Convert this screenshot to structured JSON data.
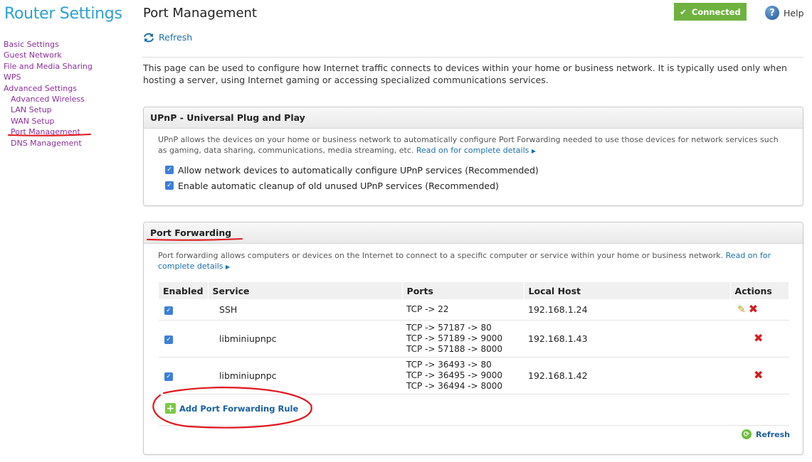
{
  "sidebar": {
    "brand": "Router Settings",
    "items": [
      {
        "label": "Basic Settings"
      },
      {
        "label": "Guest Network"
      },
      {
        "label": "File and Media Sharing"
      },
      {
        "label": "WPS"
      },
      {
        "label": "Advanced Settings"
      },
      {
        "label": "Advanced Wireless"
      },
      {
        "label": "LAN Setup"
      },
      {
        "label": "WAN Setup"
      },
      {
        "label": "Port Management"
      },
      {
        "label": "DNS Management"
      }
    ]
  },
  "header": {
    "title": "Port Management",
    "refresh_label": "Refresh",
    "status_label": "Connected",
    "help_label": "Help"
  },
  "intro": "This page can be used to configure how Internet traffic connects to devices within your home or business network. It is typically used only when hosting a server, using Internet gaming or accessing specialized communications services.",
  "upnp": {
    "title": "UPnP - Universal Plug and Play",
    "description": "UPnP allows the devices on your home or business network to automatically configure Port Forwarding needed to use those devices for network services such as gaming, data sharing, communications, media streaming, etc.",
    "link": "Read on for complete details",
    "options": [
      {
        "label": "Allow network devices to automatically configure UPnP services (Recommended)",
        "checked": true
      },
      {
        "label": "Enable automatic cleanup of old unused UPnP services (Recommended)",
        "checked": true
      }
    ]
  },
  "port_forwarding": {
    "title": "Port Forwarding",
    "description": "Port forwarding allows computers or devices on the Internet to connect to a specific computer or service within your home or business network.",
    "link_part1": "Read on for",
    "link_part2": "complete details",
    "columns": [
      "Enabled",
      "Service",
      "Ports",
      "Local Host",
      "Actions"
    ],
    "rows": [
      {
        "enabled": true,
        "service": "SSH",
        "ports": [
          "TCP -> 22"
        ],
        "host": "192.168.1.24"
      },
      {
        "enabled": true,
        "service": "libminiupnpc",
        "ports": [
          "TCP -> 57187 -> 80",
          "TCP -> 57189 -> 9000",
          "TCP -> 57188 -> 8000"
        ],
        "host": "192.168.1.43"
      },
      {
        "enabled": true,
        "service": "libminiupnpc",
        "ports": [
          "TCP -> 36493 -> 80",
          "TCP -> 36495 -> 9000",
          "TCP -> 36494 -> 8000"
        ],
        "host": "192.168.1.42"
      }
    ],
    "add_label": "Add Port Forwarding Rule",
    "refresh_label": "Refresh"
  },
  "colors": {
    "brand": "#2ba0d6",
    "nav_link": "#8a2f9a",
    "status": "#6fb23f",
    "annotation": "#e0161b"
  }
}
